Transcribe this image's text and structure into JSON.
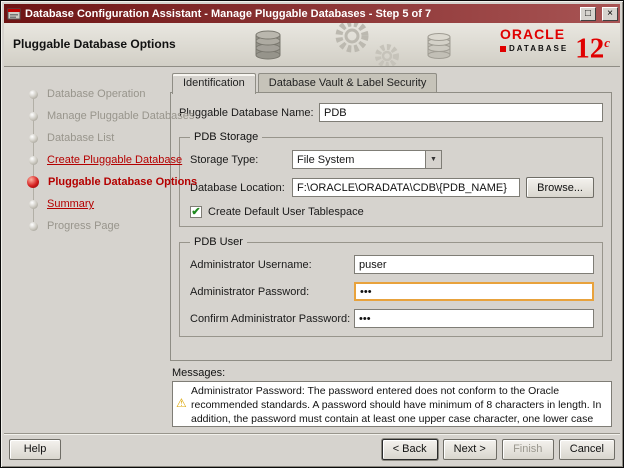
{
  "window": {
    "title": "Database Configuration Assistant - Manage Pluggable Databases - Step 5 of 7",
    "page_title": "Pluggable Database Options"
  },
  "branding": {
    "oracle": "ORACLE",
    "database": "DATABASE",
    "version": "12",
    "version_suffix": "c"
  },
  "icons": {
    "maximize": "□",
    "close": "×",
    "dropdown_arrow": "▼",
    "check": "✔",
    "warning": "⚠"
  },
  "sidebar": {
    "steps": [
      {
        "label": "Database Operation",
        "state": "completed"
      },
      {
        "label": "Manage Pluggable Databases",
        "state": "completed"
      },
      {
        "label": "Database List",
        "state": "completed"
      },
      {
        "label": "Create Pluggable Database",
        "state": "visited-link"
      },
      {
        "label": "Pluggable Database Options",
        "state": "current"
      },
      {
        "label": "Summary",
        "state": "link"
      },
      {
        "label": "Progress Page",
        "state": "pending"
      }
    ]
  },
  "tabs": [
    {
      "label": "Identification"
    },
    {
      "label": "Database Vault & Label Security"
    }
  ],
  "form": {
    "pdb_name_label": "Pluggable Database Name:",
    "pdb_name_value": "PDB",
    "storage_group_title": "PDB Storage",
    "storage_type_label": "Storage Type:",
    "storage_type_value": "File System",
    "location_label": "Database Location:",
    "location_value": "F:\\ORACLE\\ORADATA\\CDB\\{PDB_NAME}",
    "browse_label": "Browse...",
    "default_tablespace_label": "Create Default User Tablespace",
    "default_tablespace_checked": true,
    "user_group_title": "PDB User",
    "admin_username_label": "Administrator Username:",
    "admin_username_value": "puser",
    "admin_password_label": "Administrator Password:",
    "admin_password_value": "•••",
    "confirm_password_label": "Confirm Administrator Password:",
    "confirm_password_value": "•••"
  },
  "messages": {
    "label": "Messages:",
    "warning_text": "Administrator Password: The password entered does not conform to the Oracle recommended standards. A password should have minimum of 8 characters in length. In addition, the password must contain at least one upper case character, one lower case character and one digit."
  },
  "buttons": {
    "help": "Help",
    "back": "< Back",
    "next": "Next >",
    "finish": "Finish",
    "cancel": "Cancel"
  }
}
